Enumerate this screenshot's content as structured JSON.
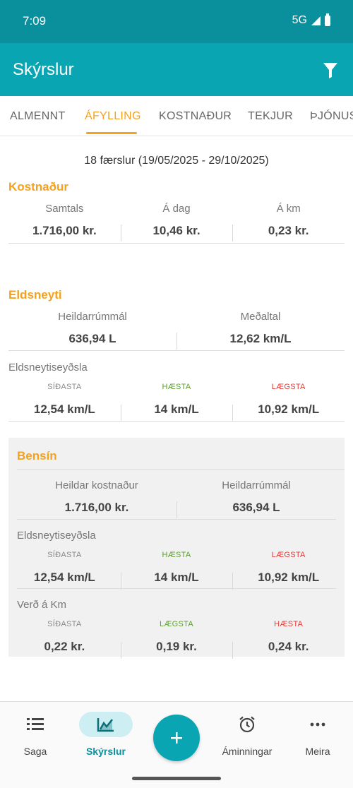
{
  "status": {
    "time": "7:09",
    "network": "5G"
  },
  "header": {
    "title": "Skýrslur",
    "filter_icon": "filter-icon"
  },
  "tabs": [
    {
      "label": "ALMENNT",
      "active": false
    },
    {
      "label": "ÁFYLLING",
      "active": true
    },
    {
      "label": "KOSTNAÐUR",
      "active": false
    },
    {
      "label": "TEKJUR",
      "active": false
    },
    {
      "label": "ÞJÓNUSTA",
      "active": false
    }
  ],
  "summary": "18 færslur (19/05/2025 - 29/10/2025)",
  "cost": {
    "title": "Kostnaður",
    "items": [
      {
        "label": "Samtals",
        "value": "1.716,00 kr."
      },
      {
        "label": "Á dag",
        "value": "10,46 kr."
      },
      {
        "label": "Á km",
        "value": "0,23 kr."
      }
    ]
  },
  "fuel": {
    "title": "Eldsneyti",
    "items": [
      {
        "label": "Heildarrúmmál",
        "value": "636,94 L"
      },
      {
        "label": "Meðaltal",
        "value": "12,62 km/L"
      }
    ],
    "consumption_label": "Eldsneytiseyðsla",
    "consumption": [
      {
        "label": "SÍÐASTA",
        "value": "12,54 km/L"
      },
      {
        "label": "HÆSTA",
        "value": "14 km/L"
      },
      {
        "label": "LÆGSTA",
        "value": "10,92 km/L"
      }
    ]
  },
  "petrol": {
    "title": "Bensín",
    "items": [
      {
        "label": "Heildar kostnaður",
        "value": "1.716,00 kr."
      },
      {
        "label": "Heildarrúmmál",
        "value": "636,94 L"
      }
    ],
    "consumption_label": "Eldsneytiseyðsla",
    "consumption": [
      {
        "label": "SÍÐASTA",
        "value": "12,54 km/L"
      },
      {
        "label": "HÆSTA",
        "value": "14 km/L"
      },
      {
        "label": "LÆGSTA",
        "value": "10,92 km/L"
      }
    ],
    "price_label": "Verð á Km",
    "price": [
      {
        "label": "SÍÐASTA",
        "value": "0,22 kr."
      },
      {
        "label": "LÆGSTA",
        "value": "0,19 kr."
      },
      {
        "label": "HÆSTA",
        "value": "0,24 kr."
      }
    ]
  },
  "nav": [
    {
      "label": "Saga",
      "icon": "list-icon"
    },
    {
      "label": "Skýrslur",
      "icon": "chart-icon",
      "active": true
    },
    {
      "label": "Áminningar",
      "icon": "alarm-icon"
    },
    {
      "label": "Meira",
      "icon": "more-icon"
    }
  ],
  "colors": {
    "primary": "#0aa5b2",
    "accent": "#f5a11c",
    "green": "#5aa02c",
    "red": "#e53935"
  }
}
